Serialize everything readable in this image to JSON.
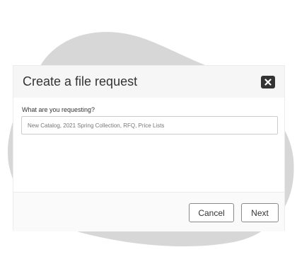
{
  "dialog": {
    "title": "Create a file request",
    "close_icon": "close-icon",
    "field_label": "What are you requesting?",
    "input_value": "",
    "input_placeholder": "New Catalog, 2021 Spring Collection, RFQ, Price Lists",
    "cancel_label": "Cancel",
    "next_label": "Next"
  },
  "colors": {
    "background_blob": "#d7d7d7",
    "header_background": "#f6f6f6",
    "close_button": "#333333",
    "text": "#333333"
  }
}
